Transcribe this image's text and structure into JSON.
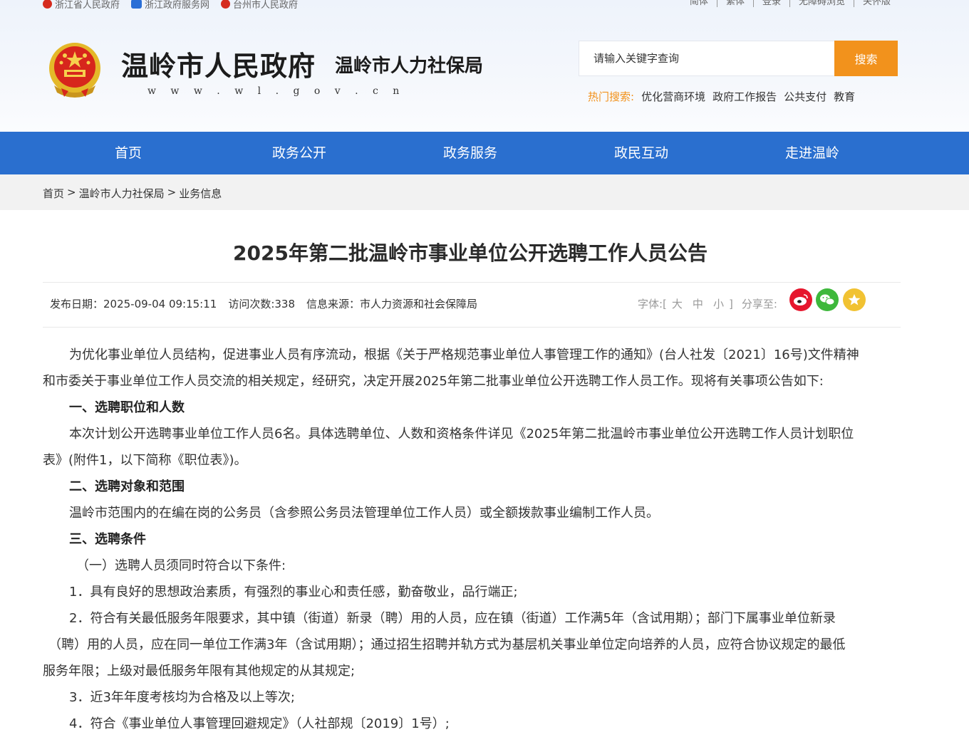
{
  "top_links": [
    {
      "label": "浙江省人民政府"
    },
    {
      "label": "浙江政府服务网"
    },
    {
      "label": "台州市人民政府"
    }
  ],
  "right_links": [
    "简体",
    "繁体",
    "登录",
    "无障碍浏览",
    "关怀版"
  ],
  "header": {
    "title": "温岭市人民政府",
    "subtitle": "温岭市人力社保局",
    "url": "w w w . w l . g o v . c n"
  },
  "search": {
    "placeholder": "请输入关键字查询",
    "button": "搜索",
    "hot_label": "热门搜索:",
    "hot_items": [
      "优化营商环境",
      "政府工作报告",
      "公共支付",
      "教育"
    ]
  },
  "nav": [
    "首页",
    "政务公开",
    "政务服务",
    "政民互动",
    "走进温岭"
  ],
  "breadcrumb": [
    "首页",
    "温岭市人力社保局",
    "业务信息"
  ],
  "breadcrumb_sep": ">",
  "article": {
    "title": "2025年第二批温岭市事业单位公开选聘工作人员公告",
    "publish_date": "发布日期：2025-09-04 09:15:11",
    "visits": "访问次数:338",
    "source": "信息来源：市人力资源和社会保障局",
    "font_label": "字体:[",
    "font_sizes": [
      "大",
      "中",
      "小"
    ],
    "font_close": "]",
    "share_label": "分享至:",
    "paragraphs": [
      "为优化事业单位人员结构，促进事业人员有序流动，根据《关于严格规范事业单位人事管理工作的通知》(台人社发〔2021〕16号)文件精神",
      "和市委关于事业单位工作人员交流的相关规定，经研究，决定开展2025年第二批事业单位公开选聘工作人员工作。现将有关事项公告如下:",
      "一、选聘职位和人数",
      "本次计划公开选聘事业单位工作人员6名。具体选聘单位、人数和资格条件详见《2025年第二批温岭市事业单位公开选聘工作人员计划职位",
      "表》(附件1，以下简称《职位表》)。",
      "二、选聘对象和范围",
      "温岭市范围内的在编在岗的公务员（含参照公务员法管理单位工作人员）或全额拨款事业编制工作人员。",
      "三、选聘条件",
      "（一）选聘人员须同时符合以下条件:",
      "1．具有良好的思想政治素质，有强烈的事业心和责任感，勤奋敬业，品行端正;",
      "2．符合有关最低服务年限要求，其中镇（街道）新录（聘）用的人员，应在镇（街道）工作满5年（含试用期）；部门下属事业单位新录",
      "（聘）用的人员，应在同一单位工作满3年（含试用期）；通过招生招聘并轨方式为基层机关事业单位定向培养的人员，应符合协议规定的最低",
      "服务年限；上级对最低服务年限有其他规定的从其规定;",
      "3．近3年年度考核均为合格及以上等次;",
      "4．符合《事业单位人事管理回避规定》（人社部规〔2019〕1号）;"
    ]
  }
}
